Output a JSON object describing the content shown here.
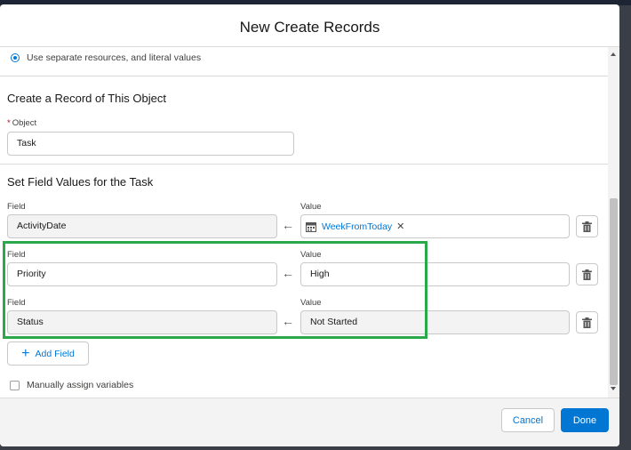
{
  "modal": {
    "title": "New Create Records"
  },
  "options": {
    "resource_mode_label": "Use separate resources, and literal values"
  },
  "object_section": {
    "title": "Create a Record of This Object",
    "object_label": "Object",
    "object_value": "Task"
  },
  "fields_section": {
    "title": "Set Field Values for the Task",
    "field_label": "Field",
    "value_label": "Value",
    "rows": [
      {
        "field": "ActivityDate",
        "value": "WeekFromToday",
        "value_is_resource": true
      },
      {
        "field": "Priority",
        "value": "High",
        "value_is_resource": false
      },
      {
        "field": "Status",
        "value": "Not Started",
        "value_is_resource": false
      }
    ],
    "arrow_glyph": "←",
    "remove_glyph": "✕",
    "add_field_label": "Add Field"
  },
  "manual_assign_label": "Manually assign variables",
  "footer": {
    "cancel_label": "Cancel",
    "done_label": "Done"
  },
  "colors": {
    "accent": "#0176d3",
    "highlight": "#2aa84a"
  }
}
